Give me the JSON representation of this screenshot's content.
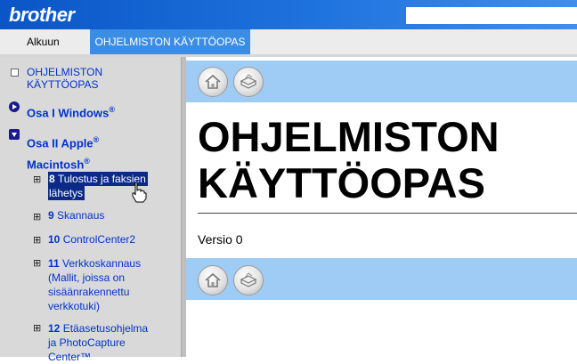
{
  "header": {
    "logo_text": "brother",
    "search_placeholder": ""
  },
  "tabs": [
    {
      "label": "Alkuun"
    },
    {
      "label": "OHJELMISTON KÄYTTÖOPAS",
      "active": true
    }
  ],
  "sidebar": {
    "root_label_line1": "OHJELMISTON",
    "root_label_line2": "KÄYTTÖOPAS",
    "section1": {
      "label": "Osa I Windows",
      "sup": "®"
    },
    "section2": {
      "label_line1": "Osa II Apple",
      "sup1": "®",
      "label_line2": "Macintosh",
      "sup2": "®"
    },
    "items": [
      {
        "num": "8",
        "label_line1": "Tulostus ja faksien",
        "label_line2": "lähetys",
        "selected": true
      },
      {
        "num": "9",
        "label": "Skannaus"
      },
      {
        "num": "10",
        "label": "ControlCenter2"
      },
      {
        "num": "11",
        "label_line1": "Verkkoskannaus",
        "label_line2": "(Mallit, joissa on",
        "label_line3": "sisäänrakennettu",
        "label_line4": "verkkotuki)"
      },
      {
        "num": "12",
        "label_line1": "Etäasetusohjelma",
        "label_line2": "ja PhotoCapture",
        "label_line3": "Center™"
      }
    ]
  },
  "main": {
    "title_line1": "OHJELMISTON",
    "title_line2": "KÄYTTÖOPAS",
    "version": "Versio 0",
    "home_icon": "home-icon",
    "print_icon": "printer-icon"
  },
  "colors": {
    "banner": "#1f73de",
    "active_tab": "#3a8de3",
    "band": "#9fccf4",
    "selection": "#0a2a86",
    "link": "#0033cc"
  }
}
